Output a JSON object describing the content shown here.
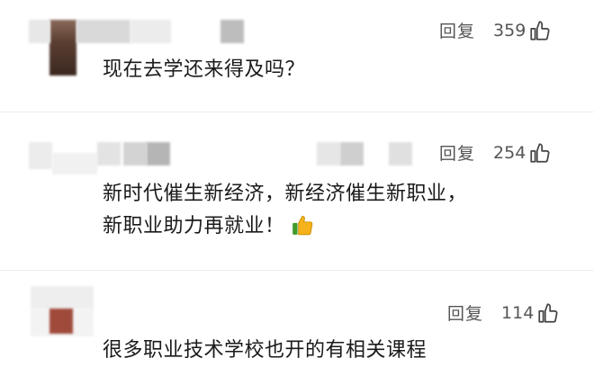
{
  "comments": [
    {
      "reply_label": "回复",
      "likes": "359",
      "lines": [
        "现在去学还来得及吗？"
      ],
      "icons": {
        "avatar": "blurred-avatar",
        "like": "thumbs-up-outline-icon"
      }
    },
    {
      "reply_label": "回复",
      "likes": "254",
      "lines": [
        "新时代催生新经济，新经济催生新职业，",
        "新职业助力再就业！"
      ],
      "icons": {
        "avatar": "blurred-avatar",
        "like": "thumbs-up-outline-icon",
        "emoji": "thumbs-up-emoji"
      }
    },
    {
      "reply_label": "回复",
      "likes": "114",
      "lines": [
        "很多职业技术学校也开的有相关课程"
      ],
      "icons": {
        "avatar": "blurred-avatar",
        "like": "thumbs-up-outline-icon"
      }
    }
  ],
  "colors": {
    "text": "#1a1a1a",
    "muted": "#555555",
    "blur_light": "#e6e6e6",
    "blur_mid": "#bdbdbd",
    "avatar_dark": "#4a3328",
    "avatar_red": "#a04a3c"
  }
}
